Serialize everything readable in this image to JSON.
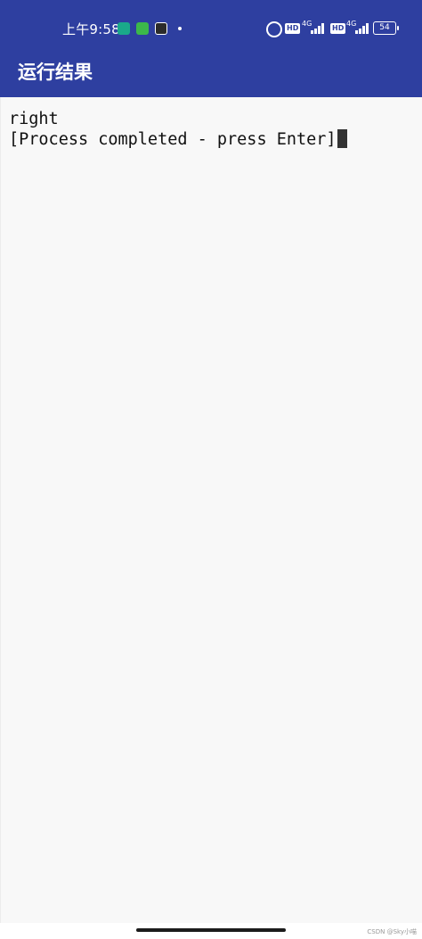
{
  "status_bar": {
    "time": "上午9:58",
    "network_1": "4G",
    "network_2": "4G",
    "hd_1": "HD",
    "hd_2": "HD",
    "battery": "54",
    "icons": [
      "app-notification-icon",
      "chat-notification-icon",
      "vpn-notification-icon",
      "more-dot-icon",
      "alarm-icon",
      "signal-icon",
      "battery-icon"
    ]
  },
  "app_bar": {
    "title": "运行结果"
  },
  "terminal": {
    "lines": [
      "right",
      "[Process completed - press Enter]"
    ]
  },
  "footer": {
    "watermark": "CSDN @Sky小喵"
  },
  "colors": {
    "primary": "#2e3fa0",
    "background": "#f8f8f8",
    "text": "#111111"
  }
}
